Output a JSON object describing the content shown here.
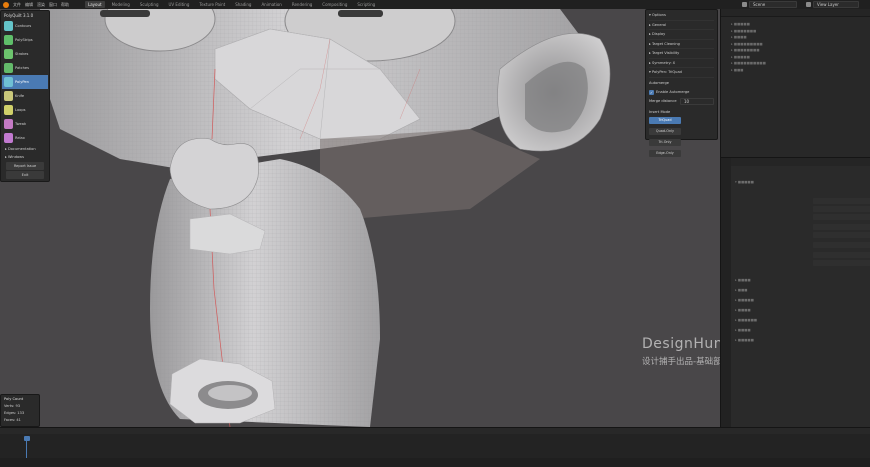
{
  "topbar": {
    "menus": [
      "文件",
      "编辑",
      "渲染",
      "窗口",
      "帮助"
    ],
    "workspaces": [
      "Layout",
      "Modeling",
      "Sculpting",
      "UV Editing",
      "Texture Paint",
      "Shading",
      "Animation",
      "Rendering",
      "Compositing",
      "Scripting"
    ],
    "active_workspace": "Layout",
    "scene": "Scene",
    "view_layer": "View Layer"
  },
  "left_panel": {
    "title": "PolyQuilt 3.1.0",
    "tools": [
      {
        "label": "Contours",
        "icon": "contours-icon",
        "color": "#64c4c9",
        "active": false
      },
      {
        "label": "PolyStrips",
        "icon": "polystrips-icon",
        "color": "#5fbf6a",
        "active": false
      },
      {
        "label": "Strokes",
        "icon": "strokes-icon",
        "color": "#6cc46d",
        "active": false
      },
      {
        "label": "Patches",
        "icon": "patches-icon",
        "color": "#63b96a",
        "active": false
      },
      {
        "label": "PolyPen",
        "icon": "polypen-icon",
        "color": "#6fc0d4",
        "active": true
      },
      {
        "label": "Knife",
        "icon": "knife-icon",
        "color": "#c9c77a",
        "active": false
      },
      {
        "label": "Loops",
        "icon": "loops-icon",
        "color": "#d0d06a",
        "active": false
      },
      {
        "label": "Tweak",
        "icon": "tweak-icon",
        "color": "#c47ac4",
        "active": false
      },
      {
        "label": "Relax",
        "icon": "relax-icon",
        "color": "#c27ad0",
        "active": false
      }
    ],
    "sections": [
      "Documentation",
      "Windows"
    ],
    "buttons": [
      "Report Issue",
      "Exit"
    ]
  },
  "right_panel": {
    "sections": [
      "Options",
      "General",
      "Display",
      "Target Cleaning",
      "Target Visibility",
      "Symmetry: X",
      "PolyPen: TriQuad"
    ],
    "automerge_label": "Automerge",
    "enable_automerge": "Enable Automerge",
    "enable_automerge_checked": true,
    "merge_distance_label": "Merge distance",
    "merge_distance_value": "10",
    "insert_mode_label": "Insert Mode",
    "insert_modes": [
      "TriQuad",
      "Quad-Only",
      "Tri-Only",
      "Edge-Only"
    ],
    "active_insert_mode": "TriQuad"
  },
  "poly_count": {
    "title": "Poly Count",
    "verts": "Verts: 93",
    "edges": "Edges: 133",
    "faces": "Faces: 41"
  },
  "watermark": {
    "line1": "DesignHunting",
    "line2": "设计捕手出品-基础部分"
  },
  "colors": {
    "accent": "#4a7ab3",
    "viewport_bg": "#494749",
    "wire": "#d15a5a",
    "mesh": "#c9c9cb"
  }
}
